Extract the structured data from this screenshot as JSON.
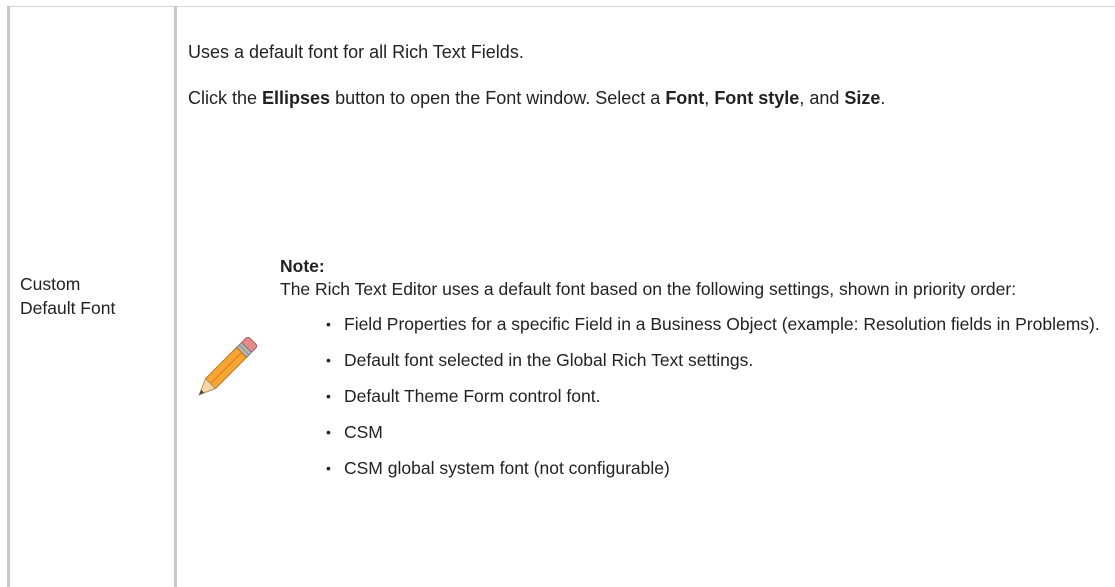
{
  "term": {
    "line1": "Custom",
    "line2": "Default Font"
  },
  "description": {
    "intro": "Uses a default font for all Rich Text Fields.",
    "instruction": {
      "part1": "Click the ",
      "bold1": "Ellipses",
      "part2": " button to open the Font window. Select a ",
      "bold2": "Font",
      "part3": ", ",
      "bold3": "Font style",
      "part4": ", and ",
      "bold4": "Size",
      "part5": "."
    }
  },
  "note": {
    "icon": "pencil-icon",
    "title": "Note:",
    "body": "The Rich Text Editor uses a default font based on the following settings, shown in priority order:",
    "items": [
      "Field Properties for a specific Field in a Business Object (example: Resolution fields in Problems).",
      "Default font selected in the Global Rich Text settings.",
      "Default Theme Form control font.",
      "CSM",
      "CSM global system font (not configurable)"
    ]
  }
}
